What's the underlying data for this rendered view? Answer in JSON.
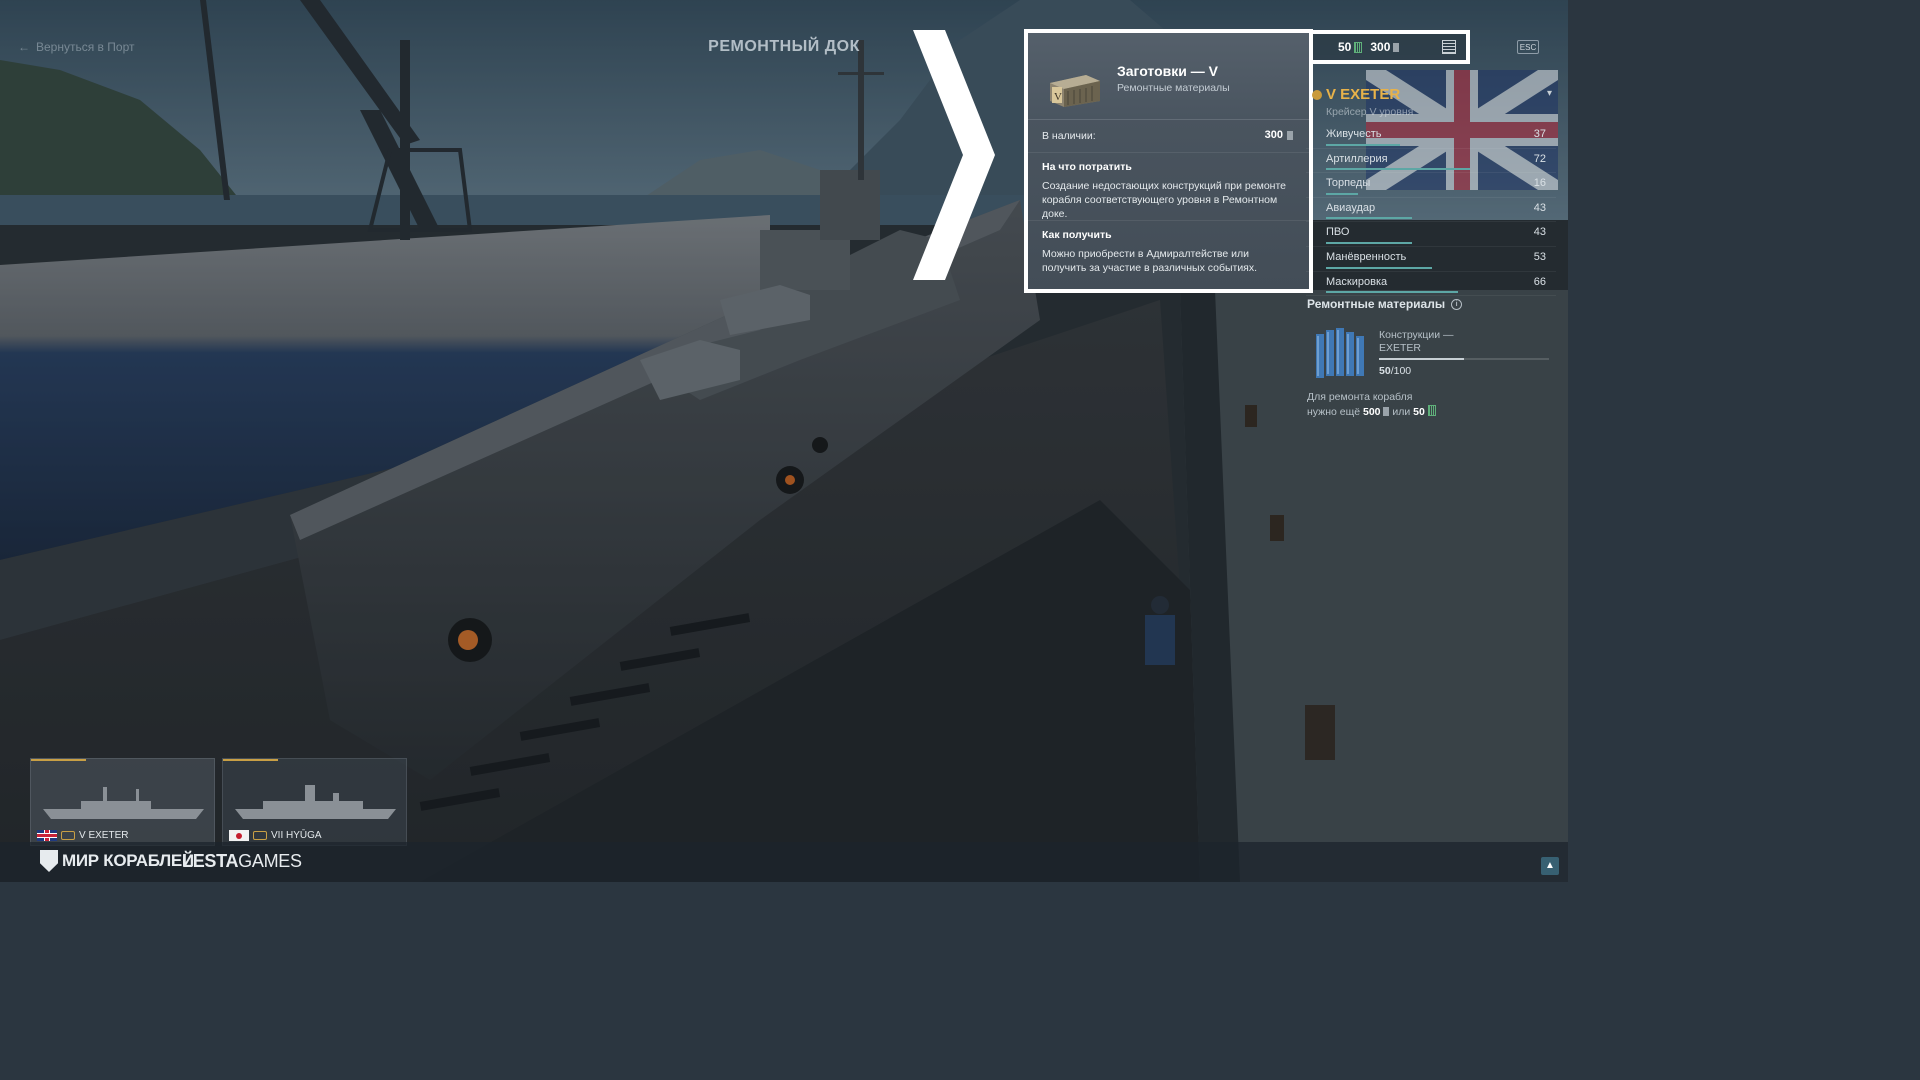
{
  "header": {
    "back_label": "Вернуться в Порт",
    "title": "РЕМОНТНЫЙ ДОК",
    "esc_label": "ESC"
  },
  "currency": {
    "item1_value": "50",
    "item1_icon": "construction-green-icon",
    "item2_value": "300",
    "item2_icon": "blank-gray-icon"
  },
  "tooltip": {
    "title": "Заготовки — V",
    "subtitle": "Ремонтные материалы",
    "stock_label": "В наличии:",
    "stock_value": "300",
    "spend_heading": "На что потратить",
    "spend_text": "Создание недостающих конструкций при ремонте корабля соответствующего уровня в Ремонтном доке.",
    "obtain_heading": "Как получить",
    "obtain_text": "Можно приобрести в Адмиралтействе или получить за участие в различных событиях."
  },
  "ship": {
    "name": "V EXETER",
    "type": "Крейсер V уровня",
    "stats": [
      {
        "label": "Живучесть",
        "value": "37",
        "fill": 0.37
      },
      {
        "label": "Артиллерия",
        "value": "72",
        "fill": 0.72
      },
      {
        "label": "Торпеды",
        "value": "16",
        "fill": 0.16
      },
      {
        "label": "Авиаудар",
        "value": "43",
        "fill": 0.43
      },
      {
        "label": "ПВО",
        "value": "43",
        "fill": 0.43
      },
      {
        "label": "Манёвренность",
        "value": "53",
        "fill": 0.53
      },
      {
        "label": "Маскировка",
        "value": "66",
        "fill": 0.66
      }
    ]
  },
  "repair": {
    "title": "Ремонтные материалы",
    "card_name_line1": "Конструкции —",
    "card_name_line2": "EXETER",
    "count_current": "50",
    "count_total": "/100",
    "progress": 0.5,
    "need_line1": "Для ремонта корабля",
    "need_prefix": "нужно ещё",
    "need_value1": "500",
    "need_or": "или",
    "need_value2": "50"
  },
  "carousel": [
    {
      "label": "V EXETER",
      "flag": "uk"
    },
    {
      "label": "VII HYŪGA",
      "flag": "jp"
    }
  ],
  "footer": {
    "logo1": "МИР КОРАБЛЕЙ",
    "logo2_bold": "LESTA",
    "logo2_rest": "GAMES"
  },
  "colors": {
    "accent_gold": "#e8b24a",
    "stat_bar": "#5da7a5",
    "highlight_border": "#ffffff"
  }
}
